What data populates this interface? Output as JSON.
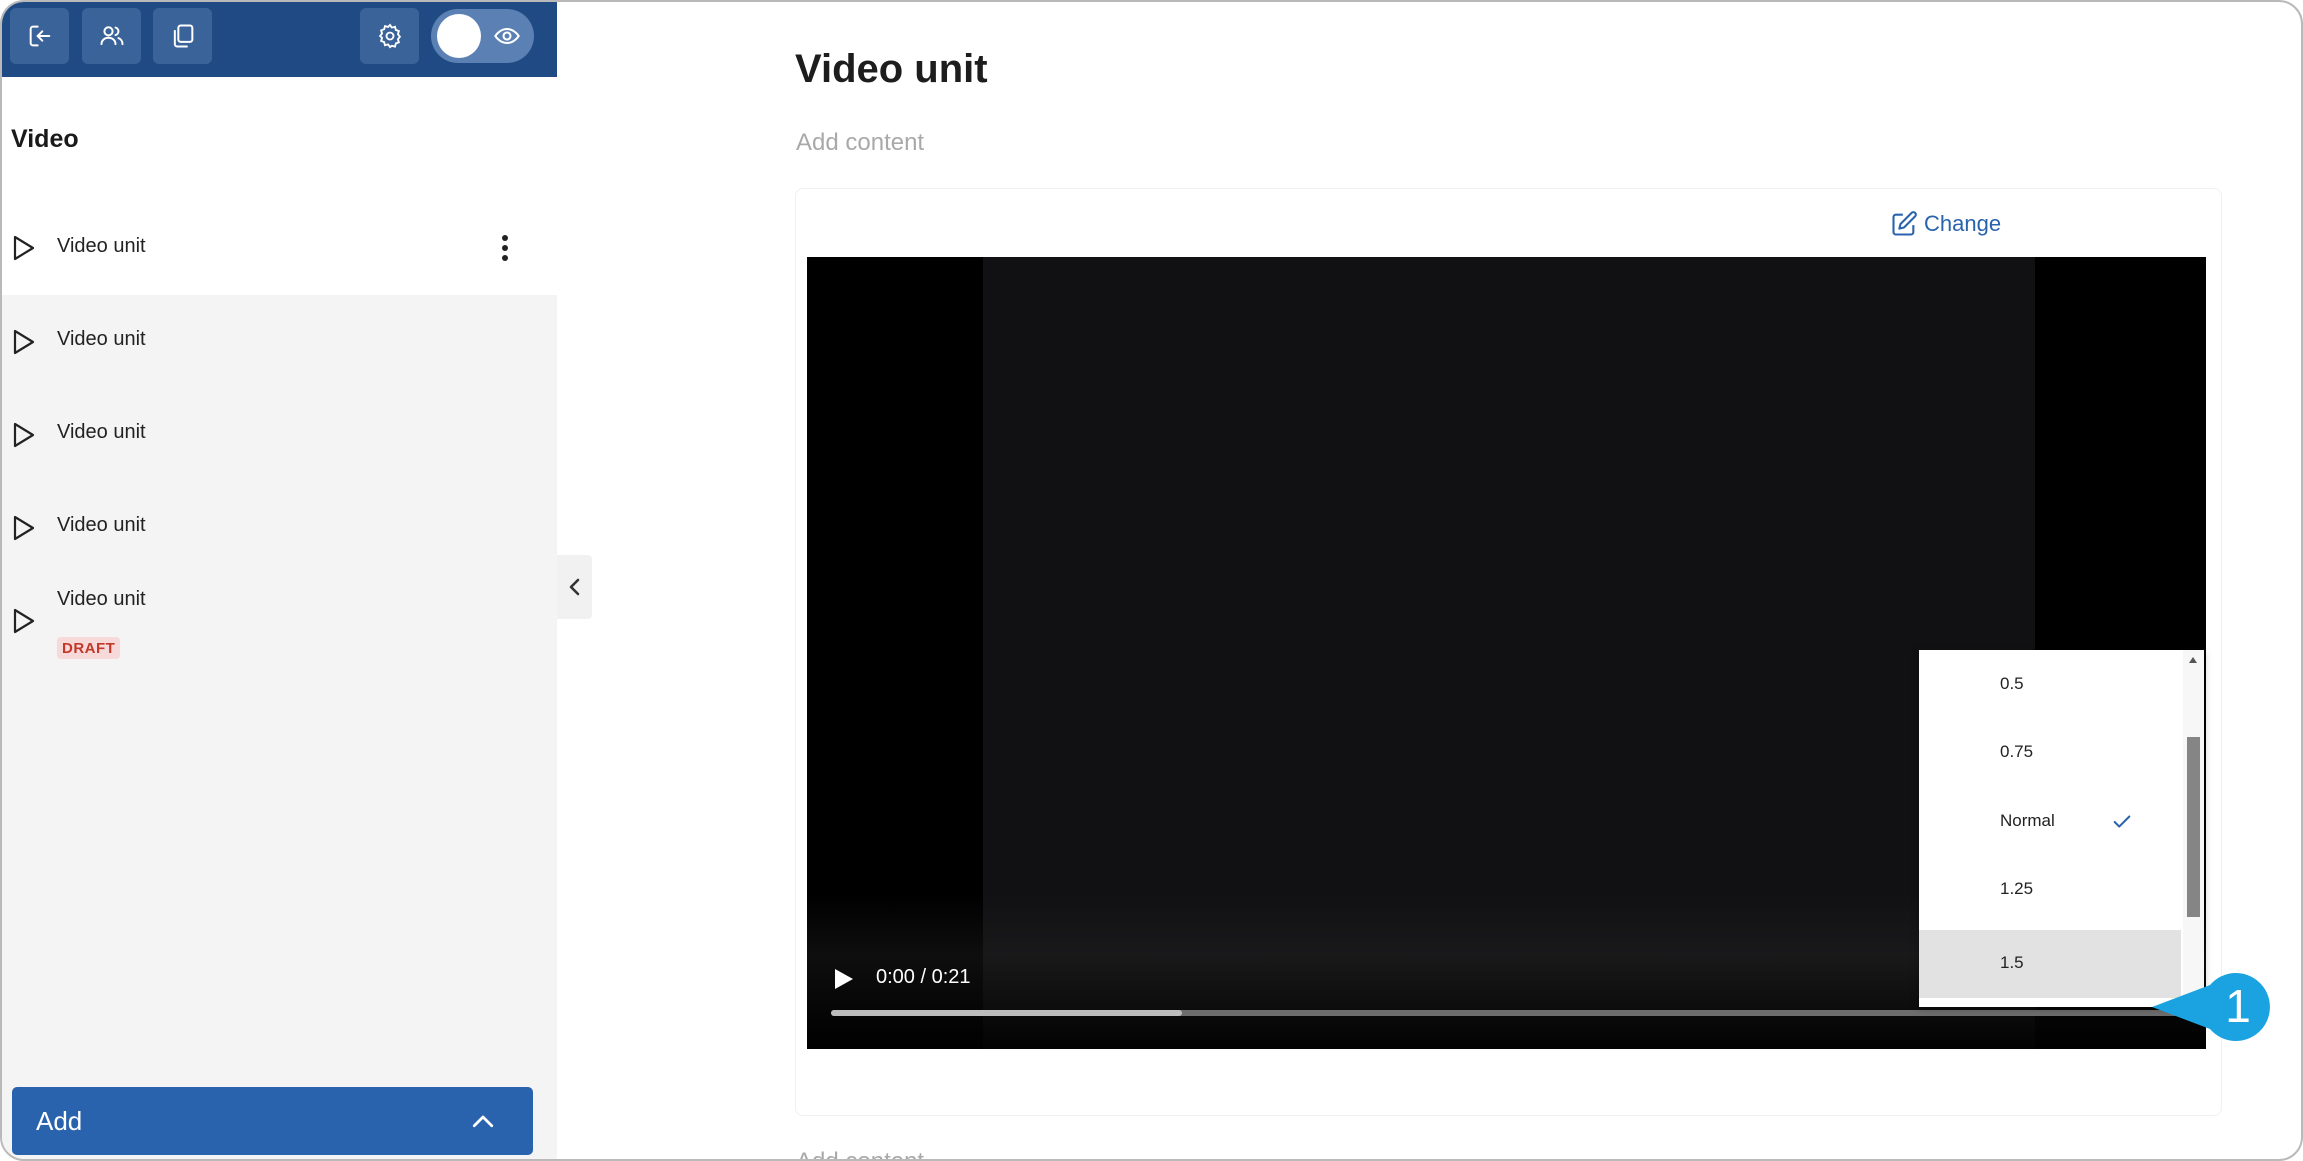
{
  "sidebar": {
    "title": "Video",
    "items": [
      {
        "label": "Video unit"
      },
      {
        "label": "Video unit"
      },
      {
        "label": "Video unit"
      },
      {
        "label": "Video unit"
      },
      {
        "label": "Video unit",
        "badge": "DRAFT"
      }
    ],
    "add_label": "Add"
  },
  "main": {
    "title": "Video unit",
    "add_content_top": "Add content",
    "add_content_bottom": "Add content",
    "change_label": "Change"
  },
  "player": {
    "time": "0:00 / 0:21",
    "buffered_fraction": 0.26,
    "speed_options": [
      "0.5",
      "0.75",
      "Normal",
      "1.25",
      "1.5"
    ],
    "selected_speed": "Normal",
    "highlighted_speed": "1.5"
  },
  "callout": {
    "number": "1"
  },
  "colors": {
    "topbar": "#1f4a84",
    "accent": "#2a63ad",
    "callout": "#1aa3e0",
    "draft_text": "#c0392b"
  }
}
